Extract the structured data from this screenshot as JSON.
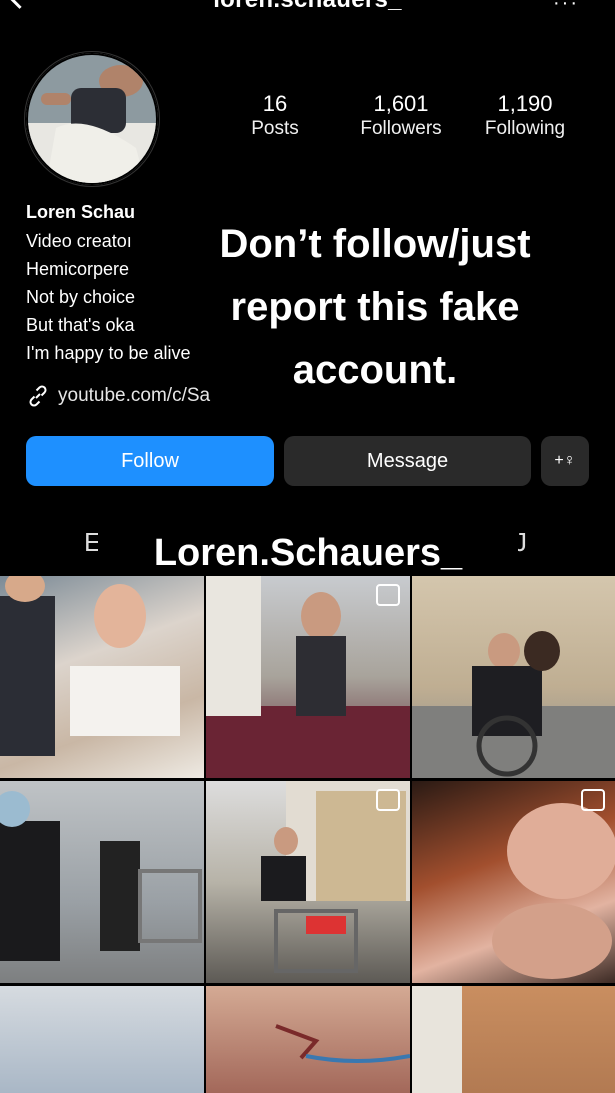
{
  "header": {
    "username": "loren.schauers_",
    "back_icon": "chevron-left-icon",
    "more_label": "···"
  },
  "profile": {
    "stats": [
      {
        "value": "16",
        "label": "Posts"
      },
      {
        "value": "1,601",
        "label": "Followers"
      },
      {
        "value": "1,190",
        "label": "Following"
      }
    ],
    "name": "Loren Schau",
    "bio_lines": [
      "Video creatoı",
      "Hemicorpere",
      "Not by choice",
      "But that's oka",
      "I'm happy to be alive"
    ],
    "link": "youtube.com/c/Sa"
  },
  "actions": {
    "follow": "Follow",
    "message": "Message",
    "add_person_icon": "+♀"
  },
  "overlay": {
    "warning": "Don’t follow/just report this fake account.",
    "caption": "Loren.Schauers_",
    "caption_left": "E",
    "caption_right": "J"
  },
  "colors": {
    "follow_button": "#1e90ff",
    "secondary_button": "#2a2a2a",
    "background": "#000000"
  }
}
